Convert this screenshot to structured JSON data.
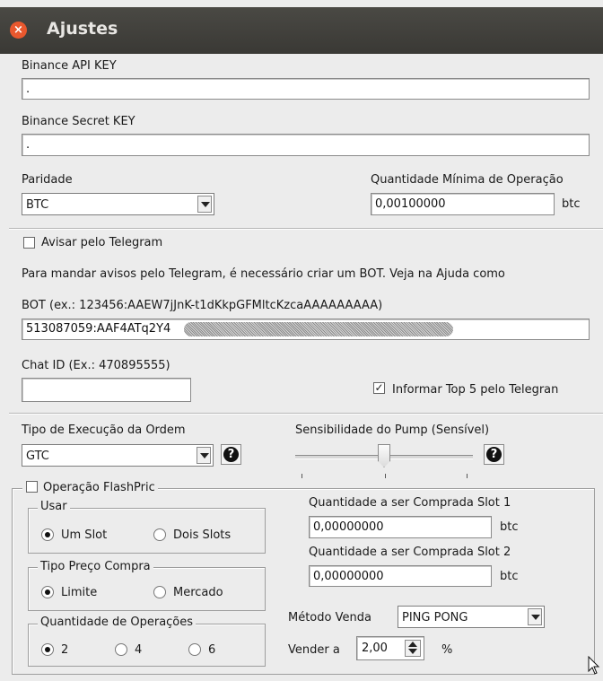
{
  "window": {
    "title": "Ajustes"
  },
  "api": {
    "label": "Binance API KEY",
    "value": "."
  },
  "secret": {
    "label": "Binance Secret KEY",
    "value": "."
  },
  "paridade": {
    "label": "Paridade",
    "selected": "BTC"
  },
  "min_op": {
    "label": "Quantidade Mínima de Operação",
    "value": "0,00100000",
    "unit": "btc"
  },
  "telegram": {
    "checkbox_label": "Avisar pelo Telegram",
    "checked": false,
    "info": "Para mandar avisos pelo Telegram, é necessário criar um BOT. Veja na Ajuda como",
    "bot_label": "BOT (ex.: 123456:AAEW7jJnK-t1dKkpGFMltcKzcaAAAAAAAAA)",
    "bot_value": "513087059:AAF4ATq2Y4",
    "chat_label": "Chat ID (Ex.: 470895555)",
    "chat_value": "",
    "top5_label": "Informar Top 5 pelo Telegran",
    "top5_checked": true
  },
  "execucao": {
    "label": "Tipo de Execução da Ordem",
    "selected": "GTC",
    "help_icon": "question-icon"
  },
  "pump": {
    "label": "Sensibilidade do Pump (Sensível)",
    "level_fraction": 0.5,
    "ticks": 3,
    "help_icon": "question-icon"
  },
  "flash": {
    "checkbox_label": "Operação FlashPric",
    "checked": false,
    "usar": {
      "title": "Usar",
      "options": [
        "Um Slot",
        "Dois Slots"
      ],
      "selected": 0
    },
    "preco": {
      "title": "Tipo Preço Compra",
      "options": [
        "Limite",
        "Mercado"
      ],
      "selected": 0
    },
    "qtd_ops": {
      "title": "Quantidade de Operações",
      "options": [
        "2",
        "4",
        "6"
      ],
      "selected": 0
    },
    "slot1": {
      "label": "Quantidade a ser Comprada Slot 1",
      "value": "0,00000000",
      "unit": "btc"
    },
    "slot2": {
      "label": "Quantidade a ser Comprada Slot 2",
      "value": "0,00000000",
      "unit": "btc"
    },
    "metodo": {
      "label": "Método Venda",
      "selected": "PING PONG"
    },
    "vender": {
      "label": "Vender a",
      "value": "2,00",
      "unit": "%"
    }
  }
}
